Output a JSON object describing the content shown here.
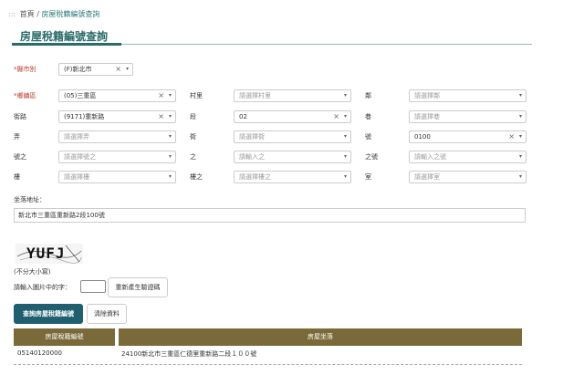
{
  "breadcrumb": {
    "dots": ":::",
    "home": "首頁",
    "sep": "/",
    "current": "房屋稅籍編號查詢"
  },
  "title": "房屋稅籍編號查詢",
  "form": {
    "city": {
      "label": "*縣市別",
      "value": "(F)新北市"
    },
    "district": {
      "label": "*鄉鎮區",
      "value": "(05)三重區"
    },
    "village": {
      "label": "村里",
      "placeholder": "請選擇村里"
    },
    "neighborhood": {
      "label": "鄰",
      "placeholder": "請選擇鄰"
    },
    "road": {
      "label": "街路",
      "value": "(9171)重新路"
    },
    "section": {
      "label": "段",
      "value": "02"
    },
    "lane": {
      "label": "巷",
      "placeholder": "請選擇巷"
    },
    "alley": {
      "label": "弄",
      "placeholder": "請選擇弄"
    },
    "street_sub": {
      "label": "衖",
      "placeholder": "請選擇衖"
    },
    "number": {
      "label": "號",
      "value": "0100"
    },
    "number_of": {
      "label": "號之",
      "placeholder": "請選擇號之"
    },
    "of": {
      "label": "之",
      "placeholder": "請輸入之"
    },
    "of_number": {
      "label": "之號",
      "placeholder": "請輸入之號"
    },
    "floor": {
      "label": "樓",
      "placeholder": "請選擇樓"
    },
    "floor_of": {
      "label": "樓之",
      "placeholder": "請選擇樓之"
    },
    "room": {
      "label": "室",
      "placeholder": "請選擇室"
    }
  },
  "address": {
    "label": "坐落地址：",
    "value": "新北市三重區重新路2段100號"
  },
  "captcha": {
    "image_text": "YUFJ",
    "case_note": "(不分大小寫)",
    "prompt": "請輸入圖片中的字：",
    "regen_label": "重新產生驗證碼"
  },
  "buttons": {
    "query": "查詢房屋稅籍編號",
    "clear": "清除資料"
  },
  "results": {
    "headers": [
      "房屋稅籍編號",
      "房屋坐落"
    ],
    "rows": [
      {
        "id": "05140120000",
        "location": "24100新北市三重區仁德里重新路二段１００號"
      }
    ]
  },
  "colors": {
    "accent": "#2b6b6b",
    "table_header": "#7a6a3a",
    "primary_button": "#1f5f6f",
    "required": "#c0392b"
  }
}
